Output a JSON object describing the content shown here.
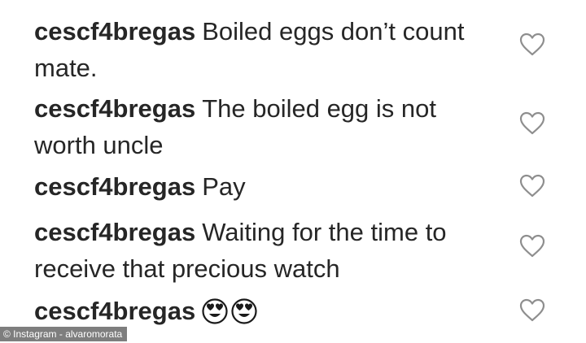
{
  "comments": [
    {
      "username": "cescf4bregas",
      "text": "Boiled eggs don’t count mate."
    },
    {
      "username": "cescf4bregas",
      "text": "The boiled egg is not worth uncle"
    },
    {
      "username": "cescf4bregas",
      "text": "Pay"
    },
    {
      "username": "cescf4bregas",
      "text": "Waiting for the time to receive that precious watch"
    },
    {
      "username": "cescf4bregas",
      "text": "",
      "emojis": [
        "heart-eyes-emoji",
        "heart-eyes-emoji"
      ]
    }
  ],
  "like_icon": "heart-outline-icon",
  "watermark": "© Instagram - alvaromorata"
}
